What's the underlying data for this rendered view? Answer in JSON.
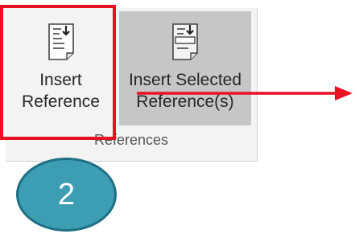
{
  "ribbon": {
    "group_label": "References",
    "buttons": [
      {
        "label_line1": "Insert",
        "label_line2": "Reference",
        "icon": "insert-reference-icon"
      },
      {
        "label_line1": "Insert Selected",
        "label_line2": "Reference(s)",
        "icon": "insert-selected-reference-icon"
      }
    ]
  },
  "annotation": {
    "highlight_color": "#e81123",
    "arrow_color": "#e81123",
    "step_number": "2",
    "step_color": "#3d9eb3"
  }
}
